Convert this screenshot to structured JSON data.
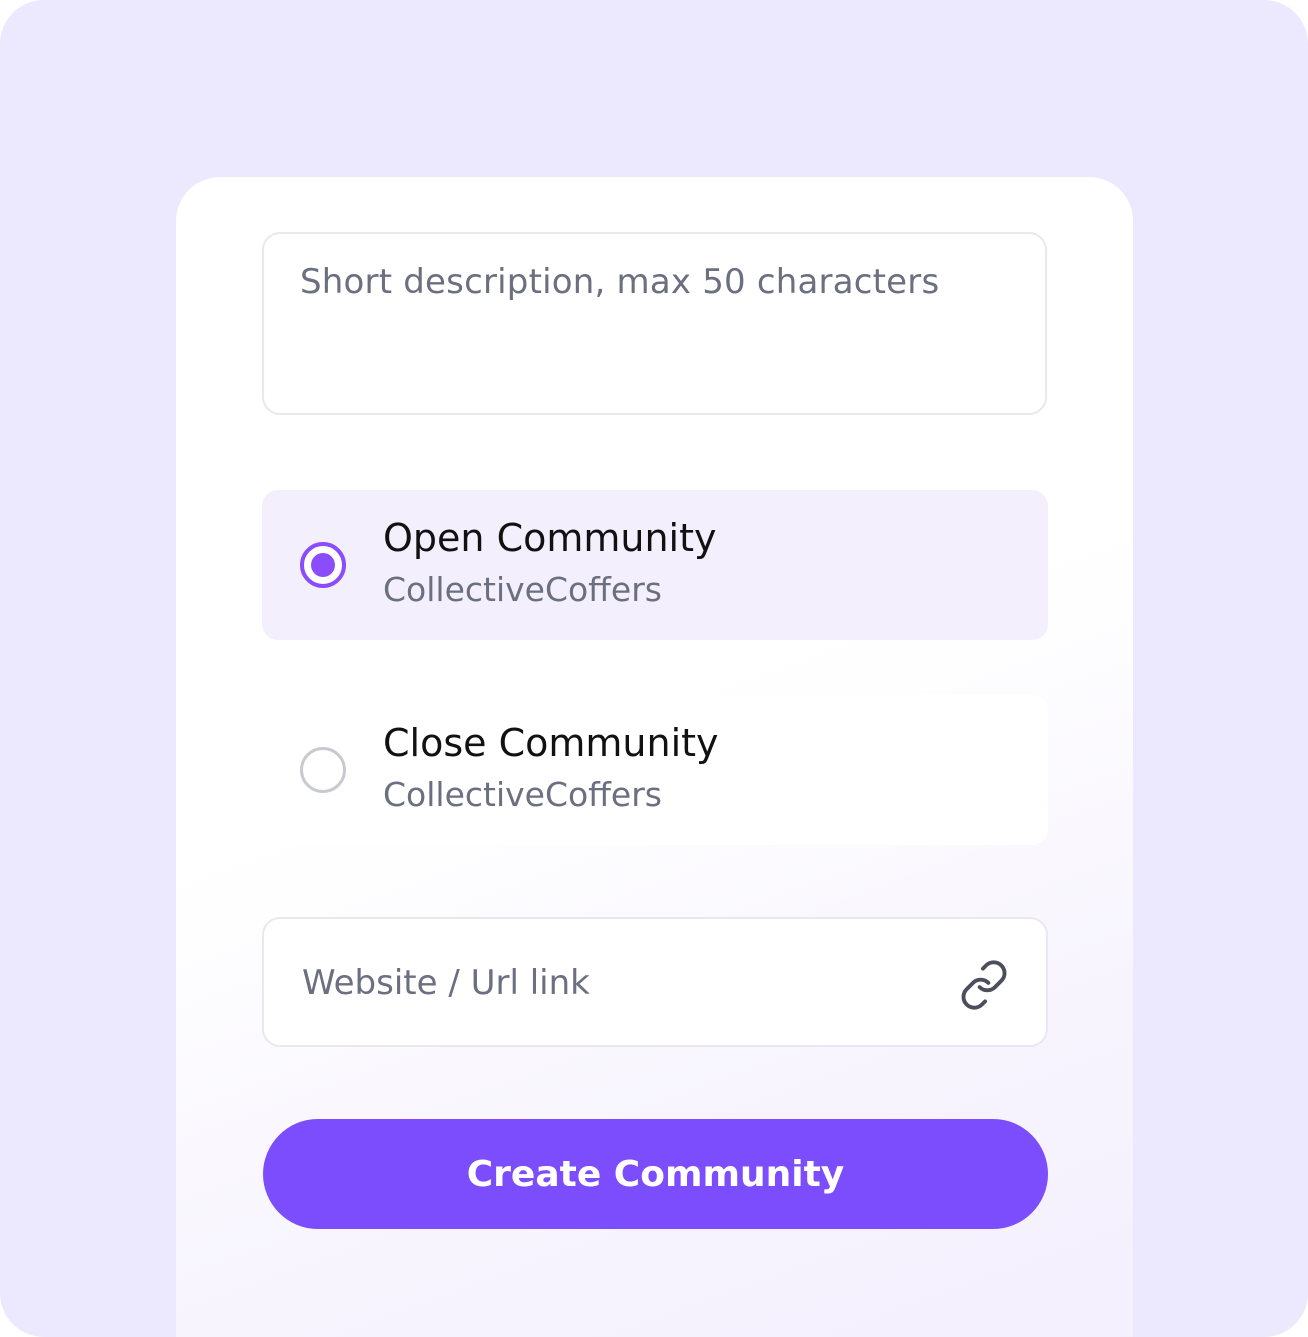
{
  "form": {
    "description_placeholder": "Short description, max 50 characters",
    "options": [
      {
        "title": "Open Community",
        "subtitle": "CollectiveCoffers",
        "selected": true
      },
      {
        "title": "Close Community",
        "subtitle": "CollectiveCoffers",
        "selected": false
      }
    ],
    "url_placeholder": "Website / Url link",
    "url_icon": "link-icon",
    "submit_label": "Create Community"
  },
  "colors": {
    "accent": "#7c4dfc",
    "radio_selected": "#8a4dfc",
    "selected_option_bg": "#f3effd",
    "background": "#ece8fd",
    "placeholder_text": "#6b6f80",
    "primary_text": "#111111"
  }
}
